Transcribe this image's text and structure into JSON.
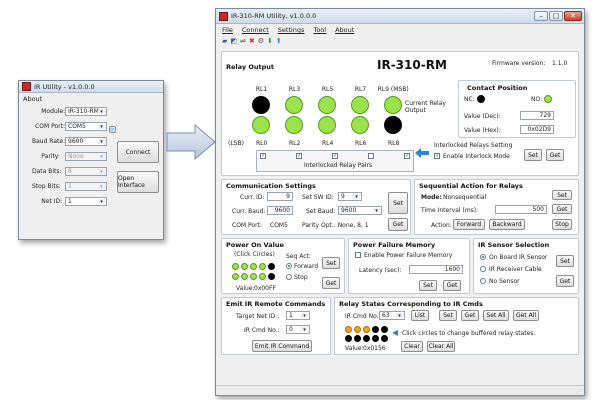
{
  "small_window": {
    "title": "IR Utility - v1.0.0.0",
    "menu": {
      "about": "About"
    },
    "fields": [
      {
        "label": "Module:",
        "value": "IR-310-RM",
        "enabled": true
      },
      {
        "label": "COM Port:",
        "value": "COM5",
        "enabled": true
      },
      {
        "label": "Baud Rate:",
        "value": "9600",
        "enabled": true
      },
      {
        "label": "Parity:",
        "value": "None",
        "enabled": false
      },
      {
        "label": "Data Bits:",
        "value": "8",
        "enabled": false
      },
      {
        "label": "Stop Bits:",
        "value": "1",
        "enabled": false
      },
      {
        "label": "Net ID:",
        "value": "1",
        "enabled": true
      }
    ],
    "connect_label": "Connect",
    "open_interface_label": "Open Interface"
  },
  "main_window": {
    "title": "IR-310-RM Utility, v1.0.0.0",
    "menu": [
      "File",
      "Connect",
      "Settings",
      "Tool",
      "About"
    ],
    "module_title": "IR-310-RM",
    "firmware_label": "Firmware version:",
    "firmware_value": "1.1.0",
    "relay_output": {
      "title": "Relay Output",
      "top_labels": [
        "RL1",
        "RL3",
        "RL5",
        "RL7",
        "RL9 (MSB)"
      ],
      "top_states": [
        "off",
        "on",
        "on",
        "on",
        "on"
      ],
      "bottom_labels": [
        "(LSB)",
        "RL0",
        "RL2",
        "RL4",
        "RL6",
        "RL8"
      ],
      "bottom_states": [
        "on",
        "on",
        "on",
        "on",
        "off"
      ],
      "current_relay_output": "Current Relay Output",
      "interlock_checks": [
        true,
        true,
        true,
        false,
        true
      ],
      "interlocked_pairs_label": "Interlocked Relay Pairs"
    },
    "contact_position": {
      "title": "Contact Position",
      "nc_label": "NC:",
      "no_label": "NO:",
      "dec_label": "Value (Dec):",
      "dec_value": "729",
      "hex_label": "Value (Hex):",
      "hex_value": "0x02D9"
    },
    "interlocked_settings": {
      "title": "Interlocked Relays Setting",
      "enable_label": "Enable Interlock Mode",
      "set": "Set",
      "get": "Get"
    },
    "communication": {
      "title": "Communication Settings",
      "curr_id_label": "Curr. ID:",
      "curr_id_value": "9",
      "curr_baud_label": "Curr. Baud:",
      "curr_baud_value": "9600",
      "com_port_label": "COM Port:",
      "com_port_value": "COM5",
      "set_sw_id_label": "Set SW ID:",
      "set_sw_id_value": "9",
      "set_baud_label": "Set Baud:",
      "set_baud_value": "9600",
      "parity_label": "Parity Opt.: None, 8, 1",
      "set": "Set",
      "get": "Get"
    },
    "sequential": {
      "title": "Sequential Action for Relays",
      "mode_label": "Mode:",
      "mode_value": "Nonsequential",
      "interval_label": "Time Interval (ms):",
      "interval_value": "500",
      "action_label": "Action:",
      "forward": "Forward",
      "backward": "Backward",
      "stop": "Stop",
      "set": "Set",
      "get": "Get"
    },
    "power_on": {
      "title": "Power On Value",
      "hint": "(Click Circles)",
      "row1": [
        "on",
        "on",
        "on",
        "on",
        "off"
      ],
      "row2": [
        "on",
        "on",
        "on",
        "on",
        "off"
      ],
      "value_label": "Value:",
      "value": "0x00FF",
      "seq_act_label": "Seq Act:",
      "forward": "Forward",
      "stop": "Stop",
      "set": "Set",
      "get": "Get"
    },
    "power_failure": {
      "title": "Power Failure Memory",
      "enable_label": "Enable Power Failure Memory",
      "latency_label": "Latency (sec):",
      "latency_value": "1600",
      "set": "Set",
      "get": "Get"
    },
    "ir_sensor": {
      "title": "IR Sensor Selection",
      "options": [
        "On Board IR Sensor",
        "IR Receiver Cable",
        "No Sensor"
      ],
      "selected": 0,
      "set": "Set",
      "get": "Get"
    },
    "emit_ir": {
      "title": "Emit IR Remote Commands",
      "target_label": "Target Net ID.:",
      "target_value": "1",
      "cmd_label": "IR Cmd No.:",
      "cmd_value": "0",
      "button": "Emit IR Command"
    },
    "relay_states": {
      "title": "Relay States Corresponding to IR Cmds",
      "cmd_label": "IR Cmd No.:",
      "cmd_value": "63",
      "list": "List",
      "set": "Set",
      "get": "Get",
      "set_all": "Set All",
      "get_all": "Get All",
      "row1": [
        "org",
        "org",
        "org",
        "off",
        "off"
      ],
      "row2": [
        "off",
        "off",
        "off",
        "off",
        "off"
      ],
      "hint": "Click circles to change buffered relay states.",
      "value_label": "Value:",
      "value": "0x0156",
      "clear": "Clear",
      "clear_all": "Clear All"
    }
  },
  "colors": {
    "on": "#9be34b",
    "off": "#000000",
    "orange": "#f5a21f",
    "arrow": "#2f86d8"
  }
}
